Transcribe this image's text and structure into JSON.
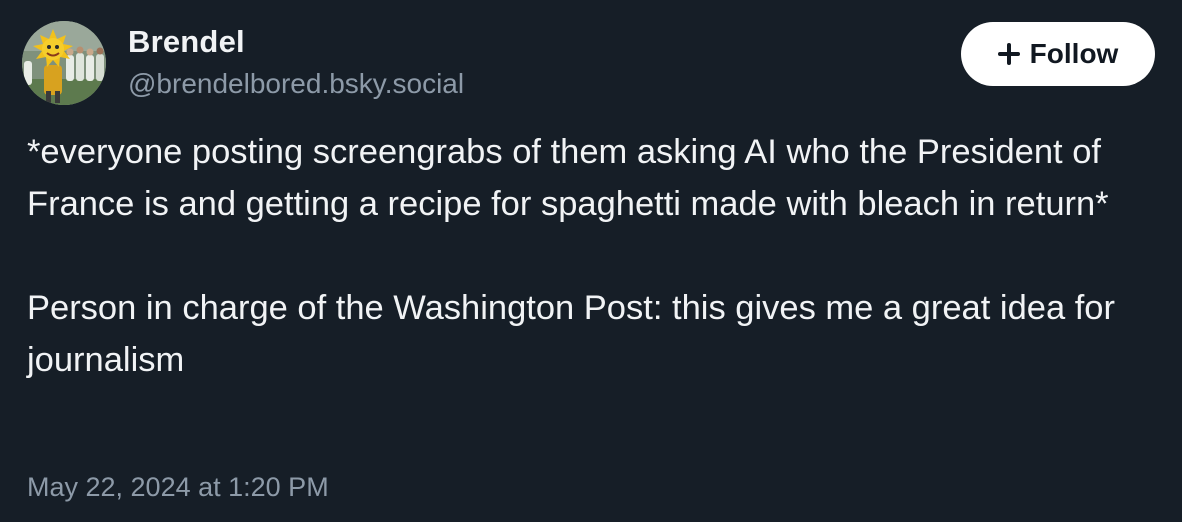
{
  "author": {
    "display_name": "Brendel",
    "handle": "@brendelbored.bsky.social",
    "avatar_icon": "mascot-avatar-icon"
  },
  "follow_button": {
    "label": "Follow",
    "icon": "plus-icon"
  },
  "post": {
    "paragraphs": [
      "*everyone posting screengrabs of them asking AI who the President of France is and getting a recipe for spaghetti made with bleach in return*",
      "Person in charge of the Washington Post: this gives me a great idea for journalism"
    ],
    "timestamp": "May 22, 2024 at 1:20 PM"
  },
  "colors": {
    "background": "#161e27",
    "text": "#f1f3f5",
    "muted": "#8d9aa8",
    "button_bg": "#ffffff"
  }
}
